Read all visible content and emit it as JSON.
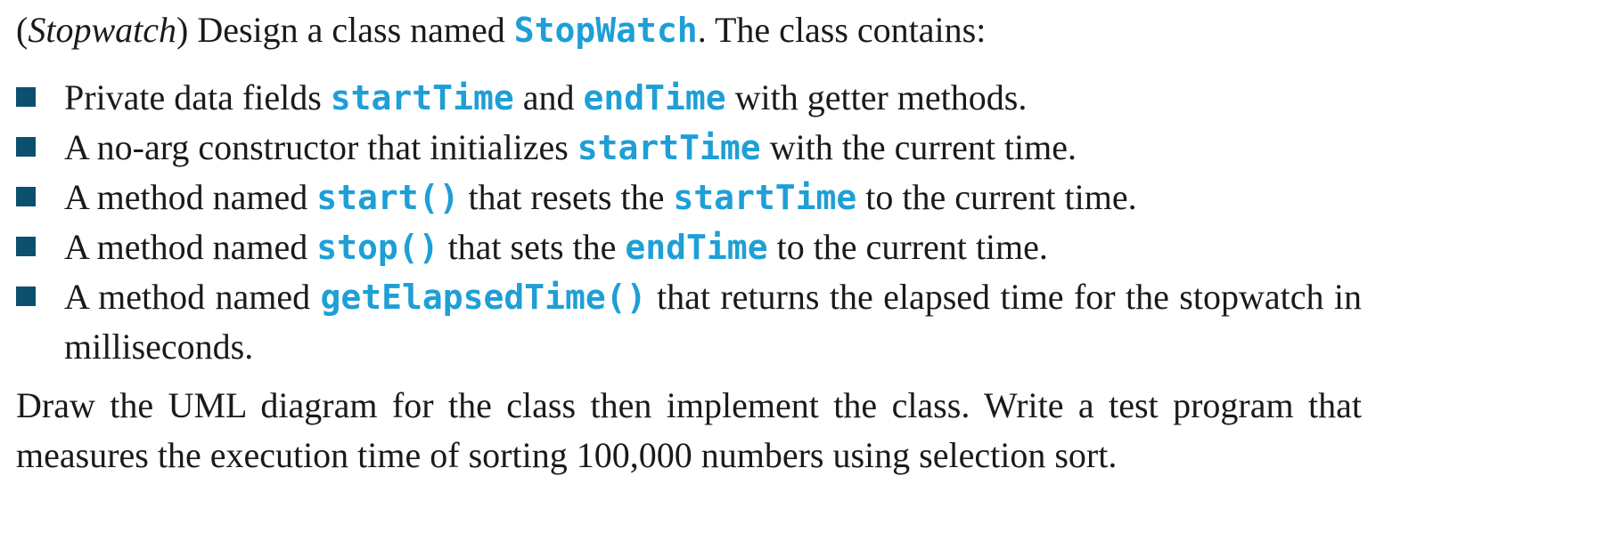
{
  "intro": {
    "term": "Stopwatch",
    "paren_open": "(",
    "paren_close": ")",
    "lead": " Design a class named ",
    "class_name": "StopWatch",
    "tail": ". The class contains:"
  },
  "bullets": [
    {
      "parts": [
        {
          "t": "Private data fields "
        },
        {
          "c": "startTime"
        },
        {
          "t": " and "
        },
        {
          "c": "endTime"
        },
        {
          "t": " with getter methods."
        }
      ]
    },
    {
      "parts": [
        {
          "t": "A no-arg constructor that initializes "
        },
        {
          "c": "startTime"
        },
        {
          "t": " with the current time."
        }
      ]
    },
    {
      "parts": [
        {
          "t": "A method named "
        },
        {
          "c": "start()"
        },
        {
          "t": " that resets the "
        },
        {
          "c": "startTime"
        },
        {
          "t": " to the current time."
        }
      ]
    },
    {
      "parts": [
        {
          "t": "A method named "
        },
        {
          "c": "stop()"
        },
        {
          "t": " that sets the "
        },
        {
          "c": "endTime"
        },
        {
          "t": " to the current time."
        }
      ]
    },
    {
      "wrap": true,
      "parts": [
        {
          "t": "A method named "
        },
        {
          "c": "getElapsedTime()"
        },
        {
          "t": " that returns the elapsed time for the stopwatch in milliseconds."
        }
      ]
    }
  ],
  "closing": "Draw the UML diagram for the class then implement the class. Write a test program that measures the execution time of sorting 100,000 numbers using selection sort.",
  "colors": {
    "code": "#1e9fd6",
    "bullet": "#0d4f6e",
    "text": "#1a1a1a"
  }
}
